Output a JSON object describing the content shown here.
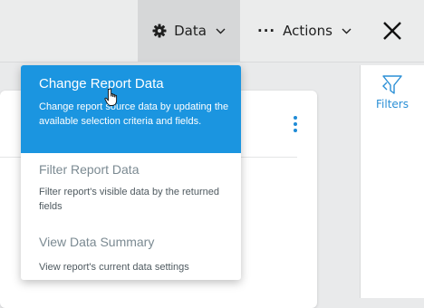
{
  "toolbar": {
    "data_label": "Data",
    "actions_label": "Actions"
  },
  "side_panel": {
    "filters_label": "Filters"
  },
  "data_menu": {
    "items": [
      {
        "title": "Change Report Data",
        "description": "Change report source data by updating the available selection criteria and fields."
      },
      {
        "title": "Filter Report Data",
        "description": "Filter report's visible data by the returned fields"
      },
      {
        "title": "View Data Summary",
        "description": "View report's current data settings"
      }
    ]
  },
  "colors": {
    "accent": "#1b95e0",
    "link": "#2a8fd6",
    "muted_title": "#7b8a92"
  }
}
